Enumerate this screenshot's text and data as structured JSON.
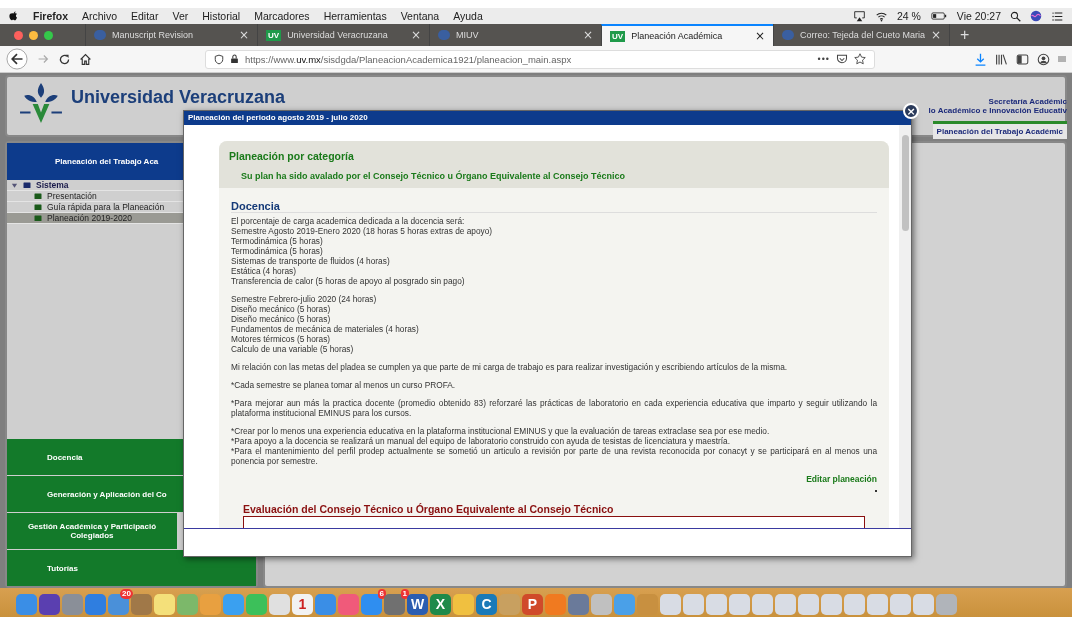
{
  "menubar": {
    "app": "Firefox",
    "items": [
      "Archivo",
      "Editar",
      "Ver",
      "Historial",
      "Marcadores",
      "Herramientas",
      "Ventana",
      "Ayuda"
    ],
    "battery": "24 %",
    "clock": "Vie 20:27"
  },
  "tabs": [
    {
      "label": "Manuscript Revision",
      "selected": false,
      "close": "×"
    },
    {
      "label": "Universidad Veracruzana",
      "selected": false,
      "close": "×",
      "badge": "UV"
    },
    {
      "label": "MIUV",
      "selected": false,
      "close": "×"
    },
    {
      "label": "Planeación Académica",
      "selected": true,
      "close": "×",
      "badge": "UV"
    },
    {
      "label": "Correo: Tejeda del Cueto Maria",
      "selected": false,
      "close": "×"
    }
  ],
  "new_tab": "+",
  "address_bar": {
    "url": "https://www.**uv.mx**/sisdgda/PlaneacionAcademica1921/planeacion_main.aspx",
    "more": "•••"
  },
  "header": {
    "title": "Universidad Veracruzana",
    "secretaria": "Secretaría Académic",
    "direccion": "lo Académico e Innovación Educativ",
    "section": "Planeación del Trabajo Académic"
  },
  "sidebar": {
    "title": "Planeación del Trabajo Aca",
    "tree": [
      {
        "label": "Sistema",
        "expanded": true,
        "selected": false,
        "children": [
          {
            "label": "Presentación",
            "selected": false
          },
          {
            "label": "Guía rápida para la Planeación",
            "selected": false
          },
          {
            "label": "Planeación 2019-2020",
            "selected": true
          }
        ]
      }
    ],
    "sections": [
      {
        "lines": [
          "Docencia"
        ]
      },
      {
        "lines": [
          "Generación y Aplicación del Co"
        ]
      },
      {
        "lines": [
          "Gestión Académica y Participació",
          "Colegiados"
        ]
      },
      {
        "lines": [
          "Tutorías"
        ]
      }
    ]
  },
  "dialog": {
    "title": "Planeación del periodo agosto 2019 - julio 2020",
    "close": "×",
    "category_title": "Planeación por categoría",
    "status": "Su plan ha sido avalado por el Consejo Técnico u Órgano Equivalente al Consejo Técnico",
    "section_title": "Docencia",
    "blocks": [
      [
        "El porcentaje de carga academica dedicada a la docencia será:",
        "Semestre Agosto 2019-Enero 2020 (18 horas 5 horas extras de apoyo)",
        "Termodinámica (5 horas)",
        "Termodinámica (5 horas)",
        "Sistemas de transporte de fluidos (4 horas)",
        "Estática (4 horas)",
        "Transferencia de calor (5 horas de apoyo al posgrado sin pago)"
      ],
      [
        "Semestre Febrero-julio 2020 (24 horas)",
        "Diseño mecánico (5 horas)",
        "Diseño mecánico (5 horas)",
        "Fundamentos de mecánica de materiales (4 horas)",
        "Motores térmicos (5 horas)",
        "Calculo de una variable (5 horas)"
      ],
      [
        "Mi relación con las metas del pladea se cumplen ya que parte de mi carga de trabajo es para realizar investigación y escribiendo artículos de la misma."
      ],
      [
        "*Cada semestre se planea tomar al menos un curso PROFA."
      ],
      [
        "*Para mejorar aun más la practica docente (promedio obtenido 83) reforzaré las prácticas de laboratorio en cada experiencia educativa que imparto y seguir utilizando la plataforma institucional EMINUS para los cursos."
      ],
      [
        "*Crear por lo menos una experiencia educativa en la plataforma institucional EMINUS y que la evaluación de tareas extraclase sea por ese medio.",
        "*Para apoyo a la docencia se realizará un manual del equipo de laboratorio construido con ayuda de tesistas de licenciatura y maestría.",
        "*Para el mantenimiento del perfil prodep actualmente se sometió un articulo a revisión por parte de una revista reconocida por conacyt y se participará en al menos una ponencia por semestre."
      ]
    ],
    "edit_link": "Editar planeación",
    "evaluation_title": "Evaluación del Consejo Técnico u Órgano Equivalente al Consejo Técnico"
  },
  "dock": [
    {
      "color": "#3a8ee6"
    },
    {
      "color": "#5a3fb0"
    },
    {
      "color": "#8a8f98"
    },
    {
      "color": "#2f7ee0"
    },
    {
      "color": "#4a90d9",
      "badge": "20"
    },
    {
      "color": "#a07848"
    },
    {
      "color": "#f4e07a"
    },
    {
      "color": "#7cb86a"
    },
    {
      "color": "#e8a040"
    },
    {
      "color": "#3aa0f0"
    },
    {
      "color": "#3cc05a"
    },
    {
      "color": "#e0e0e0"
    },
    {
      "color": "#f2f2f2",
      "glyph": "1"
    },
    {
      "color": "#3a8ee6"
    },
    {
      "color": "#f05a7a"
    },
    {
      "color": "#2f8ef0",
      "badge": "6"
    },
    {
      "color": "#707070",
      "badge": "1"
    },
    {
      "color": "#2b5db0",
      "glyph": "W"
    },
    {
      "color": "#1f8a4a",
      "glyph": "X"
    },
    {
      "color": "#f0c040"
    },
    {
      "color": "#1a7ab8",
      "glyph": "C"
    },
    {
      "color": "#c8a060"
    },
    {
      "color": "#d04a2a",
      "glyph": "P"
    },
    {
      "color": "#f07a20"
    },
    {
      "color": "#6a7a9a"
    },
    {
      "color": "#c0c0c0"
    },
    {
      "color": "#4aa0e8"
    },
    {
      "color": "#c89040"
    },
    {
      "color": "#d8dce4"
    },
    {
      "color": "#d8dce4"
    },
    {
      "color": "#d8dce4"
    },
    {
      "color": "#d8dce4"
    },
    {
      "color": "#d8dce4"
    },
    {
      "color": "#d8dce4"
    },
    {
      "color": "#d8dce4"
    },
    {
      "color": "#d8dce4"
    },
    {
      "color": "#d8dce4"
    },
    {
      "color": "#d8dce4"
    },
    {
      "color": "#d8dce4"
    },
    {
      "color": "#d8dce4"
    },
    {
      "color": "#b0b4ba"
    }
  ]
}
